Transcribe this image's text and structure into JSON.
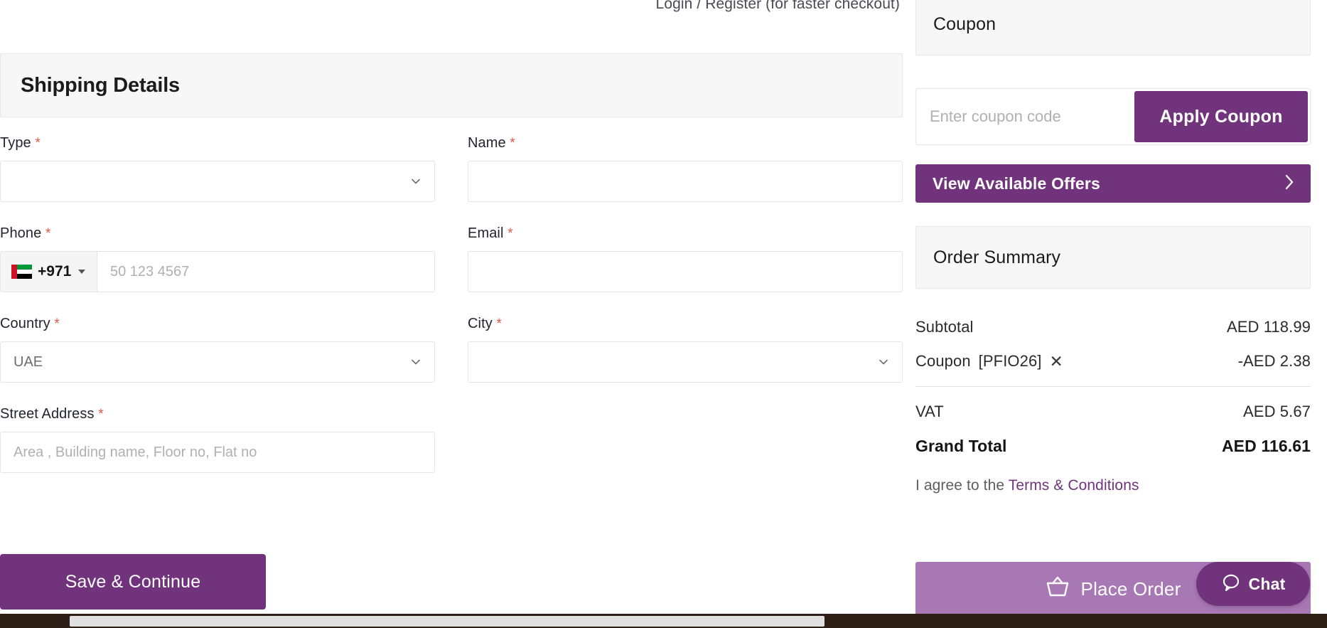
{
  "header": {
    "login_register": "Login / Register (for faster checkout)"
  },
  "shipping": {
    "title": "Shipping Details",
    "fields": {
      "type": {
        "label": "Type",
        "required": "*",
        "value": "",
        "placeholder": ""
      },
      "name": {
        "label": "Name",
        "required": "*",
        "value": "",
        "placeholder": ""
      },
      "phone": {
        "label": "Phone",
        "required": "*",
        "country_code": "+971",
        "flag": "uae-flag-icon",
        "placeholder": "50 123 4567",
        "value": ""
      },
      "email": {
        "label": "Email",
        "required": "*",
        "value": "",
        "placeholder": ""
      },
      "country": {
        "label": "Country",
        "required": "*",
        "value": "UAE"
      },
      "city": {
        "label": "City",
        "required": "*",
        "value": ""
      },
      "street": {
        "label": "Street Address",
        "required": "*",
        "placeholder": "Area , Building name, Floor no, Flat no",
        "value": ""
      }
    },
    "save_button": "Save & Continue"
  },
  "coupon": {
    "title": "Coupon",
    "input_placeholder": "Enter coupon code",
    "input_value": "",
    "apply_button": "Apply Coupon",
    "offers_label": "View Available Offers"
  },
  "order_summary": {
    "title": "Order Summary",
    "rows": [
      {
        "label": "Subtotal",
        "value": "AED 118.99",
        "code": "",
        "removable": false
      },
      {
        "label": "Coupon",
        "code": "[PFIO26]",
        "value": "-AED 2.38",
        "removable": true
      },
      {
        "label": "VAT",
        "value": "AED 5.67",
        "code": "",
        "removable": false
      },
      {
        "label": "Grand Total",
        "value": "AED 116.61",
        "code": "",
        "removable": false
      }
    ],
    "terms_prefix": "I agree to the ",
    "terms_link": "Terms & Conditions",
    "place_order_button": "Place Order"
  },
  "chat": {
    "label": "Chat"
  },
  "colors": {
    "brand_purple": "#70337c",
    "place_order_purple": "#a878b4",
    "required_red": "#e2564a",
    "panel_gray": "#f7f7f7",
    "bottom_bar": "#2e1f16"
  }
}
